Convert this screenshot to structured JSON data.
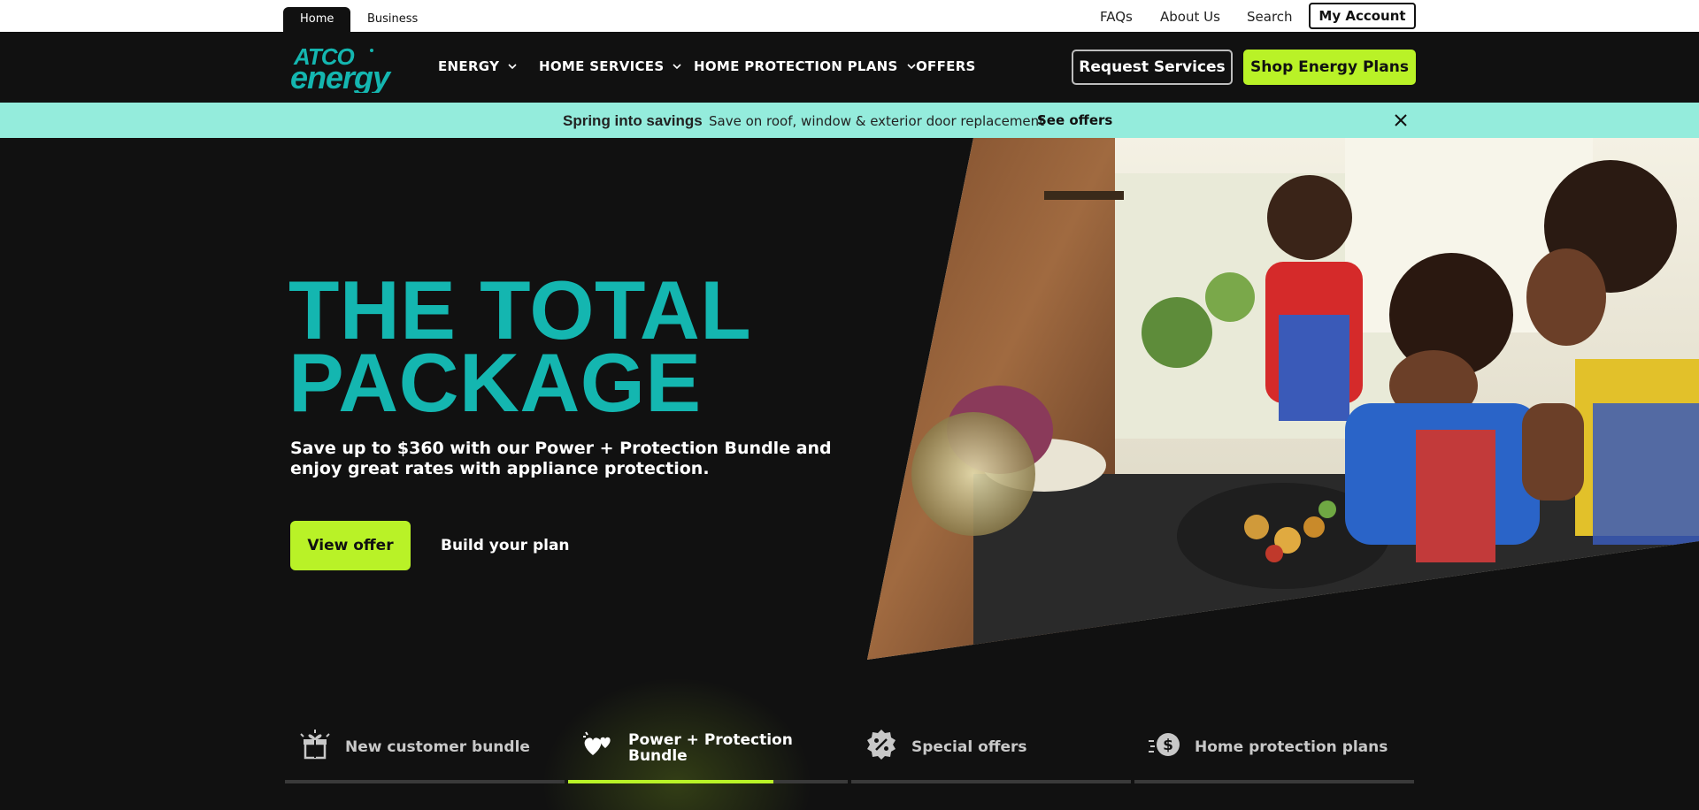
{
  "utility": {
    "tabs": [
      "Home",
      "Business"
    ],
    "links": [
      "FAQs",
      "About Us",
      "Search"
    ],
    "account": "My Account"
  },
  "nav": {
    "logo_line1": "ATCO",
    "logo_line2": "energy",
    "items": [
      "ENERGY",
      "HOME SERVICES",
      "HOME PROTECTION PLANS",
      "OFFERS"
    ],
    "request_button": "Request Services",
    "shop_button": "Shop Energy Plans"
  },
  "promo": {
    "title": "Spring into savings",
    "text": "Save on roof, window & exterior door replacement",
    "link": "See offers"
  },
  "hero": {
    "headline_line1": "THE TOTAL",
    "headline_line2": "PACKAGE",
    "subcopy": "Save up to $360 with our Power + Protection Bundle and enjoy great rates with appliance protection.",
    "primary_button": "View offer",
    "secondary_button": "Build your plan"
  },
  "tabs": [
    {
      "label": "New customer bundle",
      "icon": "gift-icon"
    },
    {
      "label": "Power + Protection",
      "label2": "Bundle",
      "icon": "hearts-icon"
    },
    {
      "label": "Special offers",
      "icon": "percent-badge-icon"
    },
    {
      "label": "Home protection plans",
      "icon": "dollar-coin-icon"
    }
  ],
  "colors": {
    "brand_teal": "#14b6b0",
    "accent_lime": "#b9f227",
    "banner_mint": "#94ecdc",
    "background": "#111111"
  }
}
